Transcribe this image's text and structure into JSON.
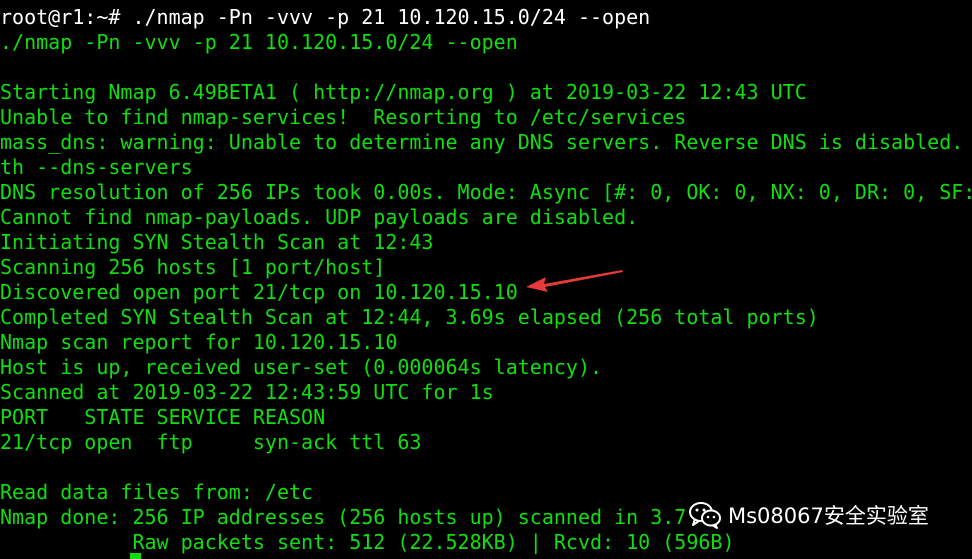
{
  "colors": {
    "background": "#000000",
    "terminal_text": "#11dd11",
    "command_text": "#ffffff",
    "arrow": "#e83a3a"
  },
  "terminal": {
    "lines": [
      {
        "text": "root@r1:~# ./nmap -Pn -vvv -p 21 10.120.15.0/24 --open",
        "color": "white"
      },
      {
        "text": "./nmap -Pn -vvv -p 21 10.120.15.0/24 --open",
        "color": "green"
      },
      {
        "text": "",
        "color": "green"
      },
      {
        "text": "Starting Nmap 6.49BETA1 ( http://nmap.org ) at 2019-03-22 12:43 UTC",
        "color": "green"
      },
      {
        "text": "Unable to find nmap-services!  Resorting to /etc/services",
        "color": "green"
      },
      {
        "text": "mass_dns: warning: Unable to determine any DNS servers. Reverse DNS is disabled. T",
        "color": "green"
      },
      {
        "text": "th --dns-servers",
        "color": "green"
      },
      {
        "text": "DNS resolution of 256 IPs took 0.00s. Mode: Async [#: 0, OK: 0, NX: 0, DR: 0, SF:",
        "color": "green"
      },
      {
        "text": "Cannot find nmap-payloads. UDP payloads are disabled.",
        "color": "green"
      },
      {
        "text": "Initiating SYN Stealth Scan at 12:43",
        "color": "green"
      },
      {
        "text": "Scanning 256 hosts [1 port/host]",
        "color": "green"
      },
      {
        "text": "Discovered open port 21/tcp on 10.120.15.10",
        "color": "green"
      },
      {
        "text": "Completed SYN Stealth Scan at 12:44, 3.69s elapsed (256 total ports)",
        "color": "green"
      },
      {
        "text": "Nmap scan report for 10.120.15.10",
        "color": "green"
      },
      {
        "text": "Host is up, received user-set (0.000064s latency).",
        "color": "green"
      },
      {
        "text": "Scanned at 2019-03-22 12:43:59 UTC for 1s",
        "color": "green"
      },
      {
        "text": "PORT   STATE SERVICE REASON",
        "color": "green"
      },
      {
        "text": "21/tcp open  ftp     syn-ack ttl 63",
        "color": "green"
      },
      {
        "text": "",
        "color": "green"
      },
      {
        "text": "Read data files from: /etc",
        "color": "green"
      },
      {
        "text": "Nmap done: 256 IP addresses (256 hosts up) scanned in 3.7",
        "color": "green"
      },
      {
        "text": "           Raw packets sent: 512 (22.528KB) | Rcvd: 10 (596B)",
        "color": "green"
      }
    ]
  },
  "watermark": {
    "icon": "wechat-icon",
    "text": "Ms08067安全实验室"
  },
  "annotation": {
    "icon": "red-arrow-icon"
  }
}
